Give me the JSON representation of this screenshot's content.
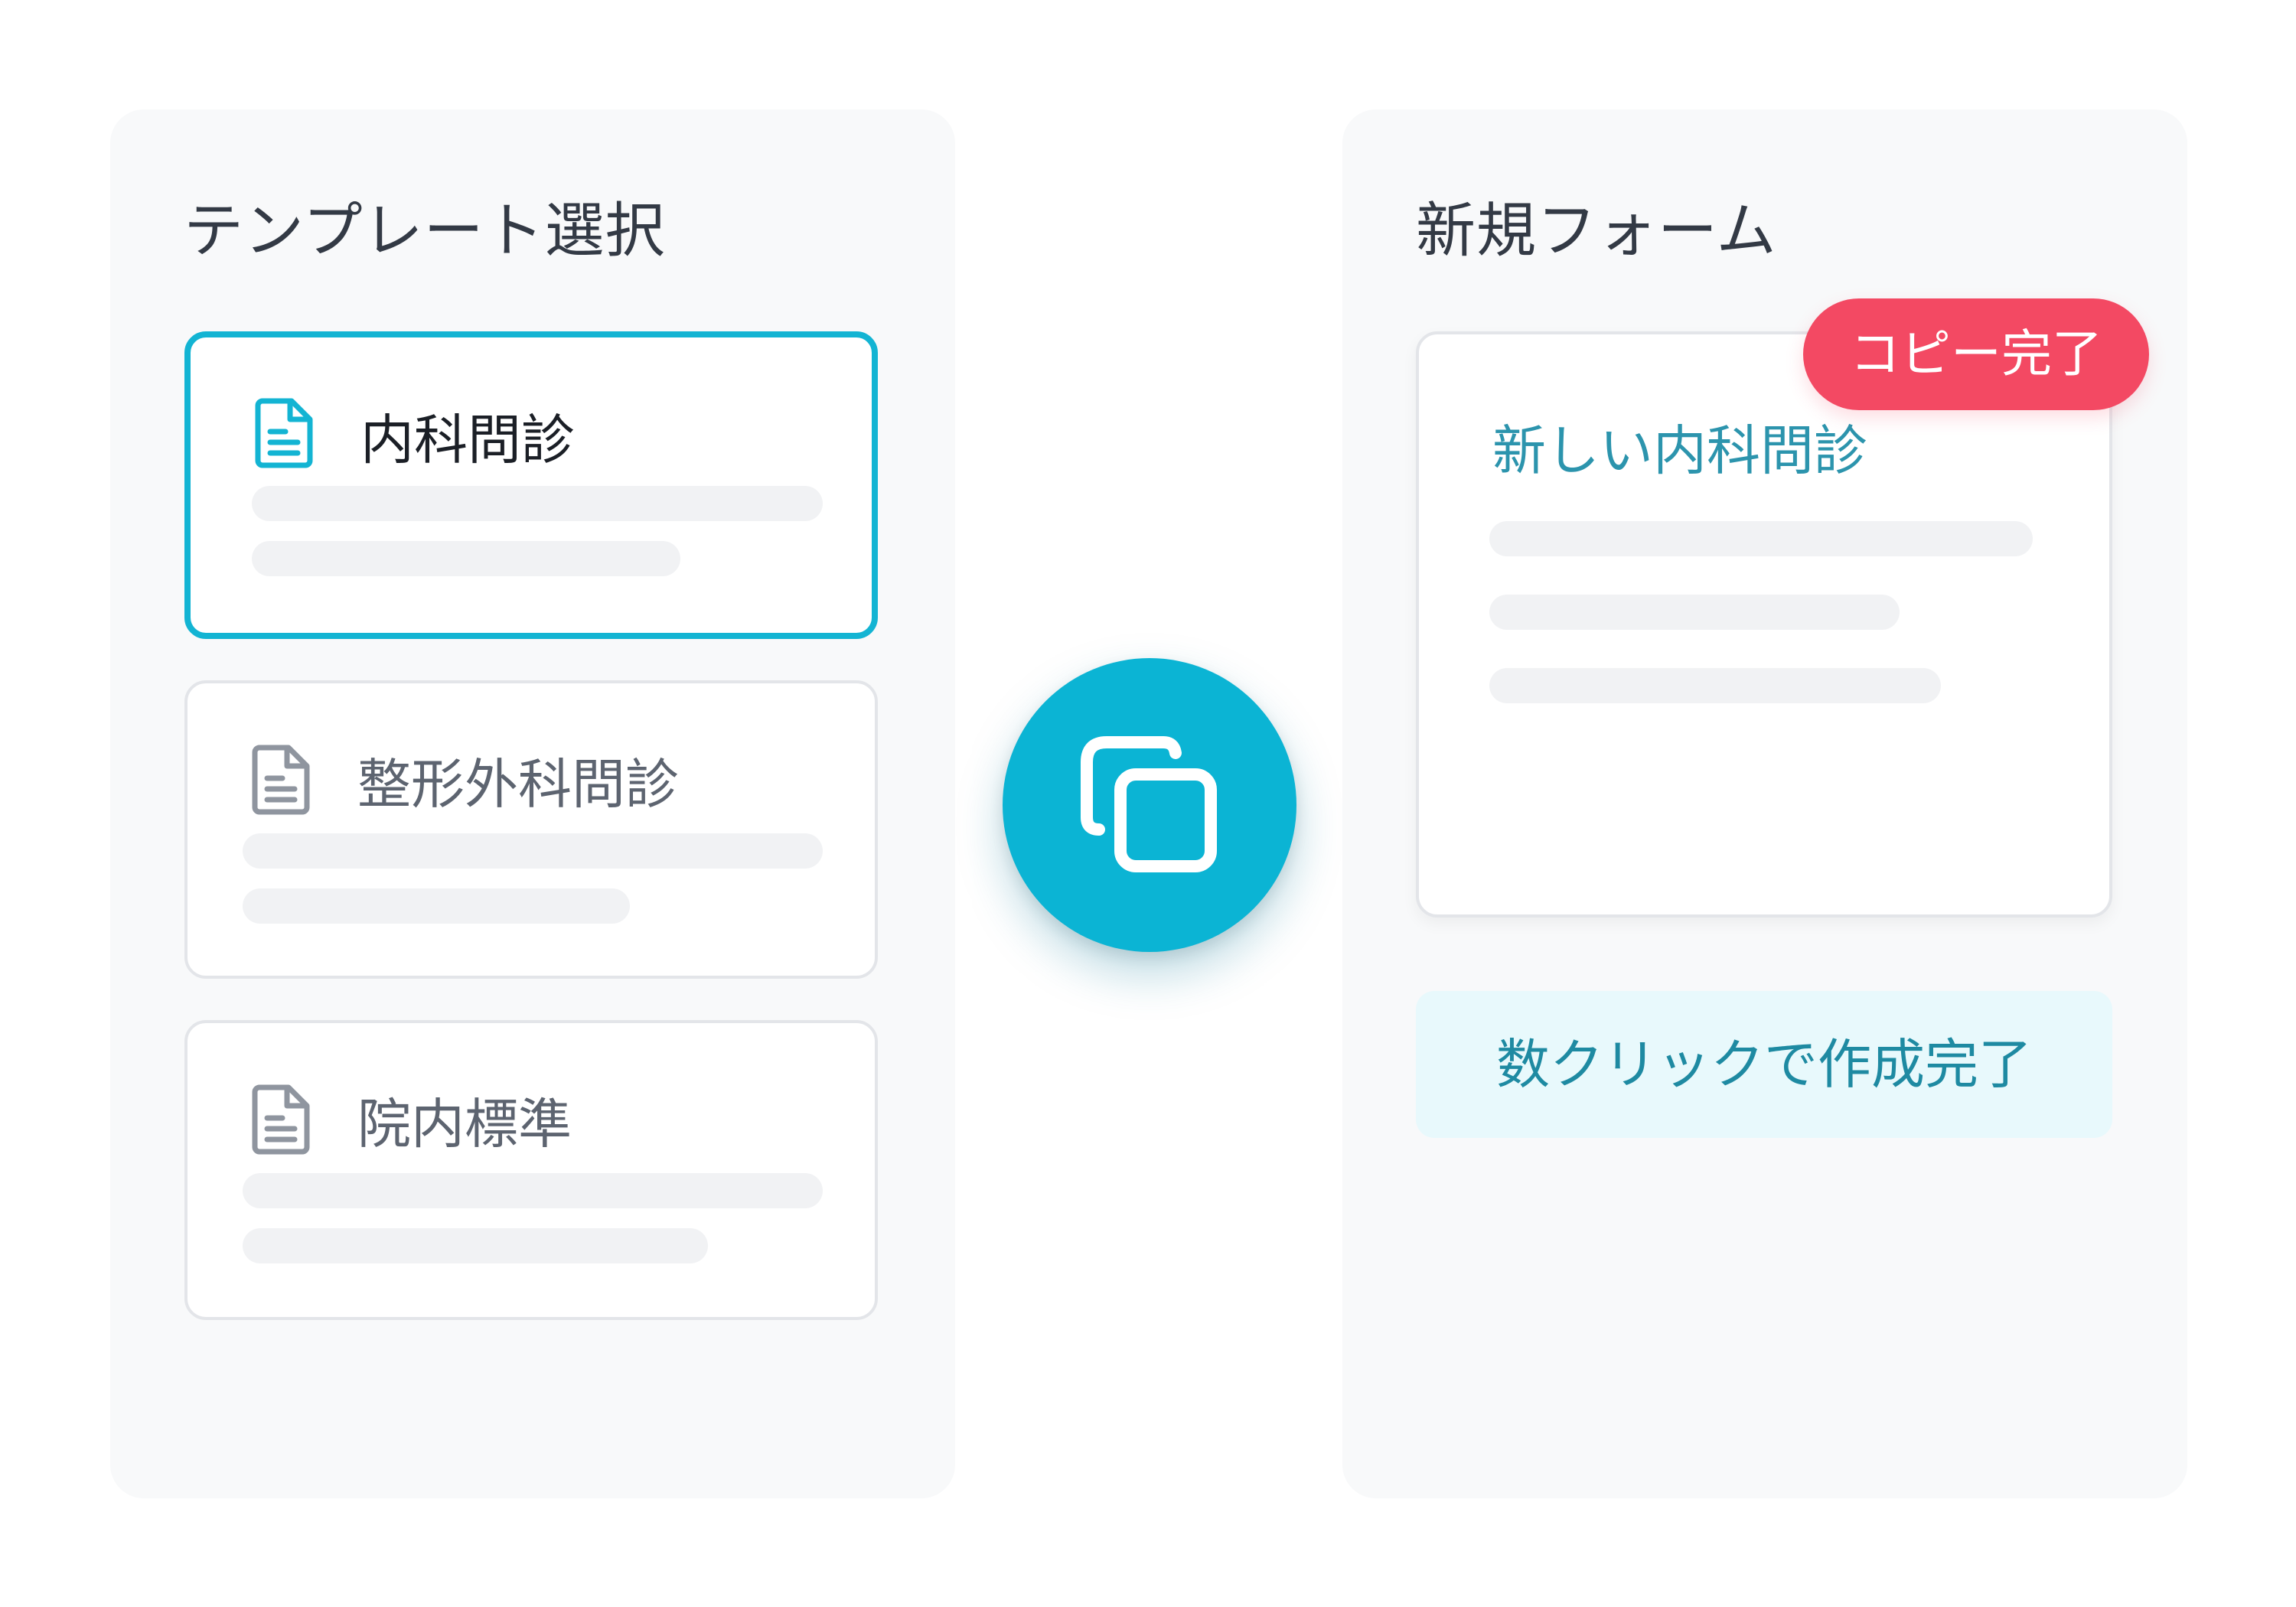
{
  "left_panel": {
    "title": "テンプレート選択",
    "templates": [
      {
        "name": "内科問診",
        "selected": true,
        "icon": "document-icon"
      },
      {
        "name": "整形外科問診",
        "selected": false,
        "icon": "document-icon"
      },
      {
        "name": "院内標準",
        "selected": false,
        "icon": "document-icon"
      }
    ]
  },
  "copy_button": {
    "icon": "copy-icon"
  },
  "right_panel": {
    "title": "新規フォーム",
    "new_form": {
      "title": "新しい内科問診",
      "badge": "コピー完了"
    },
    "info": "数クリックで作成完了"
  },
  "colors": {
    "accent": "#0bb4d4",
    "badge": "#f34963",
    "selected_border": "#13b4d3",
    "info_bg": "#e8f9fc",
    "info_text": "#1e8aa2"
  }
}
